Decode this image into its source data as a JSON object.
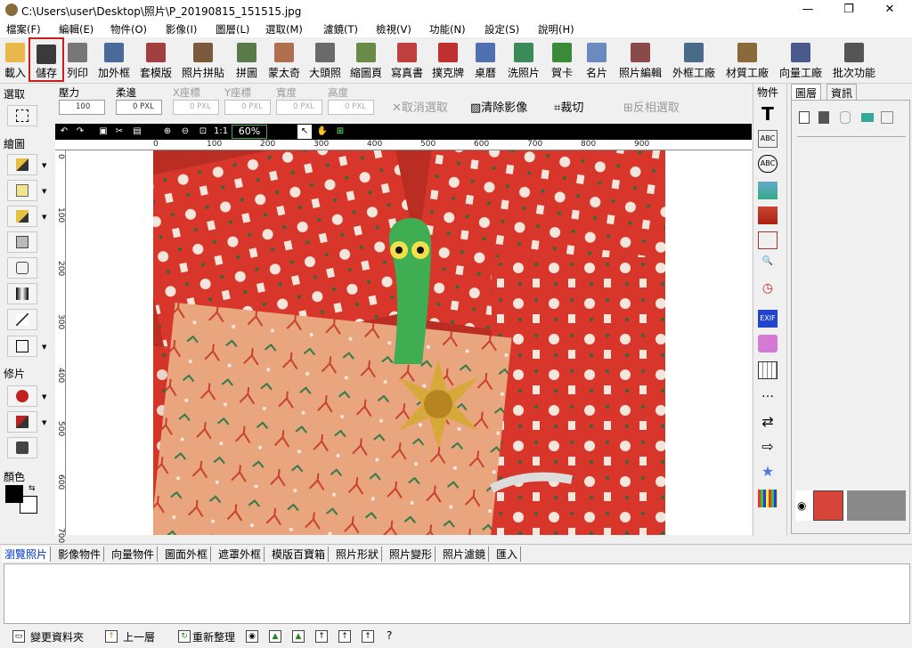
{
  "window": {
    "title": "C:\\Users\\user\\Desktop\\照片\\P_20190815_151515.jpg",
    "minimize": "—",
    "maximize": "❐",
    "close": "✕"
  },
  "menu": [
    "檔案(F)",
    "編輯(E)",
    "物件(O)",
    "影像(I)",
    "圖層(L)",
    "選取(M)",
    "濾鏡(T)",
    "檢視(V)",
    "功能(N)",
    "設定(S)",
    "說明(H)"
  ],
  "toolbar": [
    {
      "label": "載入",
      "icon": "folder-open-icon",
      "color": "#e8b84a"
    },
    {
      "label": "儲存",
      "icon": "floppy-save-icon",
      "color": "#3a3a3a"
    },
    {
      "label": "列印",
      "icon": "printer-icon",
      "color": "#777777"
    },
    {
      "label": "加外框",
      "icon": "frame-icon",
      "color": "#4a6a9a"
    },
    {
      "label": "套模版",
      "icon": "template-icon",
      "color": "#a04040"
    },
    {
      "label": "照片拼貼",
      "icon": "collage-icon",
      "color": "#7a5a3a"
    },
    {
      "label": "拼圖",
      "icon": "puzzle-icon",
      "color": "#5a7a4a"
    },
    {
      "label": "蒙太奇",
      "icon": "montage-icon",
      "color": "#b07050"
    },
    {
      "label": "大頭照",
      "icon": "id-photo-icon",
      "color": "#6a6a6a"
    },
    {
      "label": "縮圖頁",
      "icon": "thumbnail-page-icon",
      "color": "#6a8a4a"
    },
    {
      "label": "寫真書",
      "icon": "photo-book-icon",
      "color": "#c04040"
    },
    {
      "label": "撲克牌",
      "icon": "cards-icon",
      "color": "#c03030"
    },
    {
      "label": "桌曆",
      "icon": "calendar-icon",
      "color": "#5070b0"
    },
    {
      "label": "洗照片",
      "icon": "print-photo-icon",
      "color": "#3a8a5a"
    },
    {
      "label": "賀卡",
      "icon": "greeting-card-icon",
      "color": "#3a8a3a"
    },
    {
      "label": "名片",
      "icon": "business-card-icon",
      "color": "#6a8ac0"
    },
    {
      "label": "照片編輯",
      "icon": "photo-edit-icon",
      "color": "#8a4a4a"
    },
    {
      "label": "外框工廠",
      "icon": "frame-factory-icon",
      "color": "#4a6a8a"
    },
    {
      "label": "材質工廠",
      "icon": "texture-factory-icon",
      "color": "#8a6a3a"
    },
    {
      "label": "向量工廠",
      "icon": "vector-factory-icon",
      "color": "#4a5a8a"
    },
    {
      "label": "批次功能",
      "icon": "batch-icon",
      "color": "#555555"
    }
  ],
  "options": {
    "pressure_label": "壓力",
    "pressure_value": "100",
    "feather_label": "柔邊",
    "feather_value": "0",
    "x_label": "X座標",
    "x_value": "0",
    "y_label": "Y座標",
    "y_value": "0",
    "width_label": "寬度",
    "width_value": "0",
    "height_label": "高度",
    "height_value": "0",
    "unit": "PXL",
    "cancel_select": "取消選取",
    "clear_image": "清除影像",
    "crop": "裁切",
    "invert_select": "反相選取"
  },
  "left": {
    "select": "選取",
    "draw": "繪圖",
    "retouch": "修片",
    "color": "顏色"
  },
  "view": {
    "zoom": "60%"
  },
  "ruler": {
    "h": [
      "0",
      "100",
      "200",
      "300",
      "400",
      "500",
      "600",
      "700",
      "800",
      "900"
    ],
    "v": [
      "0",
      "100",
      "200",
      "300",
      "400",
      "500",
      "600",
      "700"
    ]
  },
  "right": {
    "objects_title": "物件",
    "objects": [
      "T",
      "ABC",
      "ABC",
      "",
      "",
      "",
      "🔍",
      "◷",
      "EXIF",
      "",
      "",
      "…",
      "⇄",
      "⇨",
      "★",
      ""
    ],
    "layers_tab": "圖層",
    "info_tab": "資訊"
  },
  "bottom_tabs": [
    "瀏覽照片",
    "影像物件",
    "向量物件",
    "圖面外框",
    "遮罩外框",
    "模版百寶箱",
    "照片形狀",
    "照片變形",
    "照片濾鏡",
    "匯入"
  ],
  "status": {
    "change_folder": "變更資料夾",
    "up_level": "上一層",
    "refresh": "重新整理"
  }
}
